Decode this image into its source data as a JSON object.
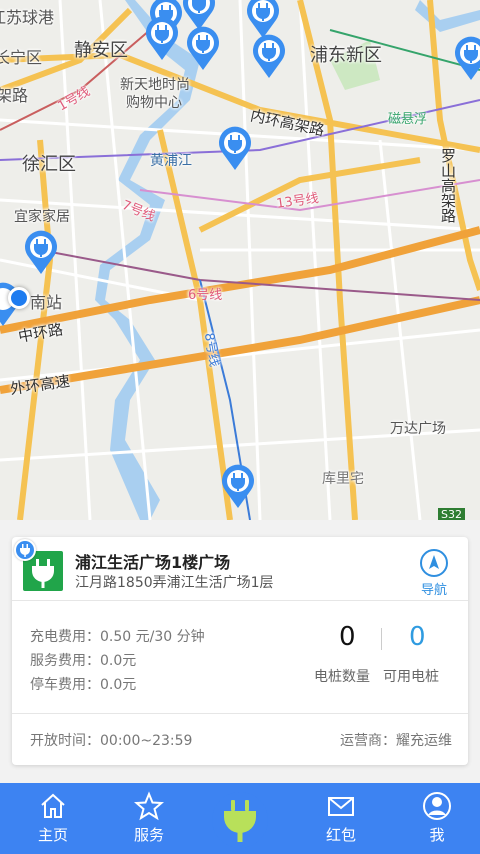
{
  "map": {
    "labels": {
      "jingan": "静安区",
      "pudong": "浦东新区",
      "xuhui": "徐汇区",
      "xintiandi": "新天地时尚",
      "xintiandi2": "购物中心",
      "neihuan": "内环高架路",
      "huangpujiang": "黄浦江",
      "luoshan": "罗山高架路",
      "yijia": "宜家家居",
      "nanzhan": "南站",
      "zhonghuan": "中环路",
      "waihuan": "外环高速",
      "wanda": "万达广场",
      "kulizhai": "库里宅",
      "line1": "1号线",
      "line7": "7号线",
      "line13": "13号线",
      "line6": "6号线",
      "line8": "8号线",
      "cidan": "磁悬浮",
      "zhangning": "长宁区",
      "qiuchang": "江苏球港",
      "gaojia": "架路",
      "s32": "S32"
    }
  },
  "station": {
    "name": "浦江生活广场1楼广场",
    "address": "江月路1850弄浦江生活广场1层",
    "nav_label": "导航",
    "fees": {
      "charge": "充电费用：0.50 元/30 分钟",
      "service": "服务费用：0.0元",
      "parking": "停车费用：0.0元"
    },
    "pile_count": "0",
    "available_count": "0",
    "pile_count_label": "电桩数量",
    "available_label": "可用电桩",
    "open_time": "开放时间：00:00~23:59",
    "operator": "运营商：耀充运维"
  },
  "tabs": [
    {
      "label": "主页",
      "icon": "home-icon"
    },
    {
      "label": "服务",
      "icon": "star-icon"
    },
    {
      "label": "",
      "icon": "plug-icon"
    },
    {
      "label": "红包",
      "icon": "envelope-icon"
    },
    {
      "label": "我",
      "icon": "user-icon"
    }
  ],
  "colors": {
    "accent": "#3d83f2",
    "station_green": "#21a54a",
    "available_blue": "#2f9be0"
  }
}
